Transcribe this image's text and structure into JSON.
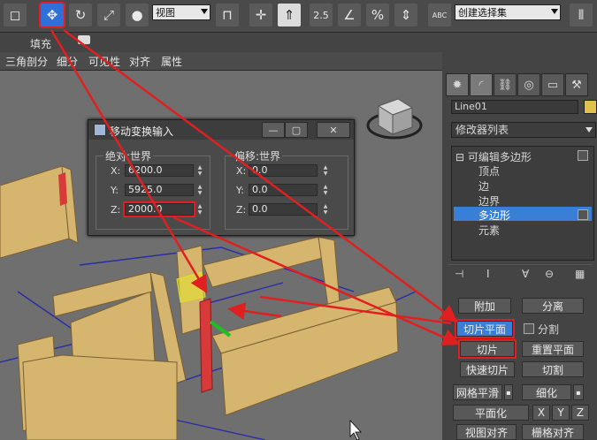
{
  "toolbar": {
    "view_combo": "视图",
    "selection_combo": "创建选择集",
    "snap_label": "2.5",
    "percent_label": "%",
    "abc_label": "ABC"
  },
  "ribbon": {
    "fill_label": "填充",
    "items": [
      "三角剖分",
      "细分",
      "可见性",
      "对齐",
      "属性"
    ]
  },
  "panel": {
    "object_name": "Line01",
    "modifier_list": "修改器列表",
    "stack": [
      {
        "label": "可编辑多边形",
        "selected": false
      },
      {
        "label": "顶点",
        "selected": false
      },
      {
        "label": "边",
        "selected": false
      },
      {
        "label": "边界",
        "selected": false
      },
      {
        "label": "多边形",
        "selected": true
      },
      {
        "label": "元素",
        "selected": false
      }
    ],
    "buttons": {
      "attach": "附加",
      "detach": "分离",
      "slice_plane": "切片平面",
      "split": "分割",
      "slice": "切片",
      "reset_plane": "重置平面",
      "quickslice": "快速切片",
      "cut": "切割",
      "meshsmooth": "网格平滑",
      "tessellate": "细化",
      "make_planar": "平面化",
      "x": "X",
      "y": "Y",
      "z": "Z",
      "view_align": "视图对齐",
      "grid_align": "栅格对齐"
    },
    "colors": {
      "selection": "#3a7fd6",
      "swatch": "#e0c24a"
    }
  },
  "dialog": {
    "title": "移动变换输入",
    "absolute": {
      "label": "绝对:世界",
      "x_label": "X:",
      "x": "6200.0",
      "y_label": "Y:",
      "y": "5925.0",
      "z_label": "Z:",
      "z": "2000.0"
    },
    "offset": {
      "label": "偏移:世界",
      "x_label": "X:",
      "x": "0.0",
      "y_label": "Y:",
      "y": "0.0",
      "z_label": "Z:",
      "z": "0.0"
    }
  },
  "annotation_color": "#e02020"
}
